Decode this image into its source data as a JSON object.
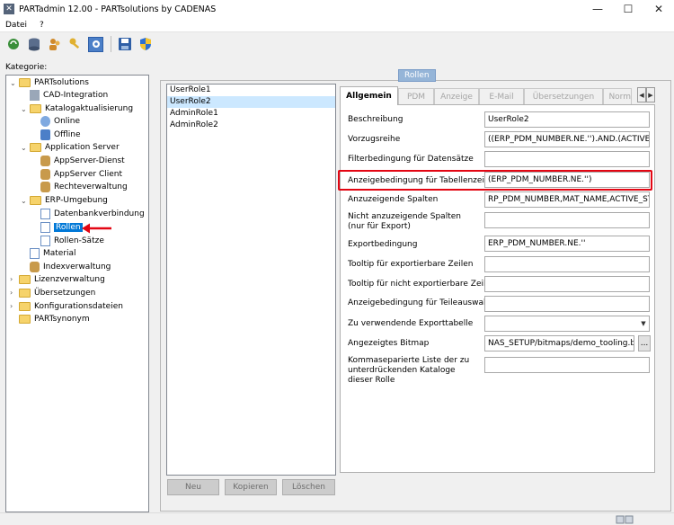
{
  "window": {
    "title": "PARTadmin 12.00 - PARTsolutions by CADENAS"
  },
  "menu": {
    "file": "Datei",
    "help": "?"
  },
  "toolbar": {
    "icons": [
      "refresh-icon",
      "database-icon",
      "users-icon",
      "keys-icon",
      "settings-icon",
      "save-icon",
      "shield-icon"
    ]
  },
  "tree": {
    "label": "Kategorie:",
    "items": [
      {
        "label": "PARTsolutions"
      },
      {
        "label": "CAD-Integration"
      },
      {
        "label": "Katalogaktualisierung"
      },
      {
        "label": "Online"
      },
      {
        "label": "Offline"
      },
      {
        "label": "Application Server"
      },
      {
        "label": "AppServer-Dienst"
      },
      {
        "label": "AppServer Client"
      },
      {
        "label": "Rechteverwaltung"
      },
      {
        "label": "ERP-Umgebung"
      },
      {
        "label": "Datenbankverbindung"
      },
      {
        "label": "Rollen"
      },
      {
        "label": "Rollen-Sätze"
      },
      {
        "label": "Material"
      },
      {
        "label": "Indexverwaltung"
      },
      {
        "label": "Lizenzverwaltung"
      },
      {
        "label": "Übersetzungen"
      },
      {
        "label": "Konfigurationsdateien"
      },
      {
        "label": "PARTsynonym"
      }
    ]
  },
  "roles": {
    "title": "Rollen",
    "items": [
      "UserRole1",
      "UserRole2",
      "AdminRole1",
      "AdminRole2"
    ],
    "selected": "UserRole2",
    "buttons": {
      "new": "Neu",
      "copy": "Kopieren",
      "delete": "Löschen"
    }
  },
  "tabs": [
    "Allgemein",
    "PDM",
    "Anzeige",
    "E-Mail",
    "Übersetzungen",
    "Norm"
  ],
  "form": {
    "fields": [
      {
        "label": "Beschreibung",
        "value": "UserRole2"
      },
      {
        "label": "Vorzugsreihe",
        "value": "((ERP_PDM_NUMBER.NE.'').AND.(ACTIVE_STA"
      },
      {
        "label": "Filterbedingung für Datensätze",
        "value": ""
      },
      {
        "label": "Anzeigebedingung für Tabellenzeilen",
        "value": "(ERP_PDM_NUMBER.NE.'')"
      },
      {
        "label": "Anzuzeigende Spalten",
        "value": "RP_PDM_NUMBER,MAT_NAME,ACTIVE_STATE"
      },
      {
        "label": "Nicht anzuzeigende Spalten (nur für Export)",
        "value": ""
      },
      {
        "label": "Exportbedingung",
        "value": "ERP_PDM_NUMBER.NE.''"
      },
      {
        "label": "Tooltip für exportierbare Zeilen",
        "value": ""
      },
      {
        "label": "Tooltip für nicht exportierbare Zeilen",
        "value": ""
      },
      {
        "label": "Anzeigebedingung für Teileauswahl",
        "value": ""
      },
      {
        "label": "Zu verwendende Exporttabelle",
        "value": ""
      },
      {
        "label": "Angezeigtes Bitmap",
        "value": "NAS_SETUP/bitmaps/demo_tooling.bmp"
      },
      {
        "label": "Kommaseparierte Liste der zu unterdrückenden Kataloge dieser Rolle",
        "value": ""
      }
    ],
    "browse_label": "..."
  },
  "colors": {
    "accent": "#0078d7",
    "highlight": "#e30613",
    "group_title": "#95b5d8"
  }
}
